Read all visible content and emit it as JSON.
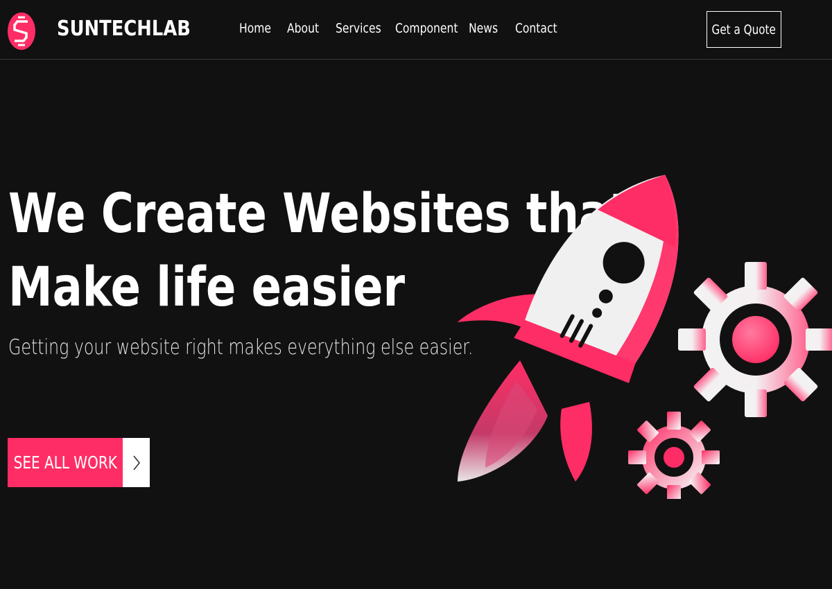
{
  "header": {
    "brand": "SUNTECHLAB",
    "nav": [
      "Home",
      "About",
      "Services",
      "Component",
      "News",
      "Contact"
    ],
    "quote_button": "Get a Quote"
  },
  "hero": {
    "title_line1": "We Create Websites that",
    "title_line2": "Make life easier",
    "subtitle": "Getting your website right makes everything else easier.",
    "cta_label": "SEE ALL WORK"
  },
  "colors": {
    "background": "#121112",
    "accent": "#ff2d65",
    "text": "#ffffff"
  },
  "icons": {
    "logo": "s-logo-icon",
    "cta_arrow": "chevron-right-icon",
    "illustration": "rocket-and-gears-illustration"
  }
}
